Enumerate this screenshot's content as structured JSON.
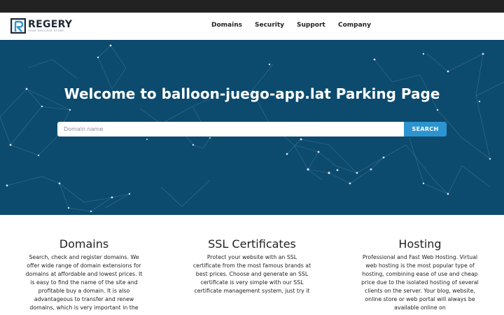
{
  "brand": {
    "name": "REGERY",
    "tagline": "YOUR SUCCESS STORY",
    "colors": {
      "primary": "#1f2a36",
      "accent": "#2c95d1",
      "hero_bg": "#0c4a6e"
    }
  },
  "nav": {
    "items": [
      {
        "label": "Domains"
      },
      {
        "label": "Security"
      },
      {
        "label": "Support"
      },
      {
        "label": "Company"
      }
    ]
  },
  "hero": {
    "title": "Welcome to balloon-juego-app.lat Parking Page",
    "search": {
      "placeholder": "Domain name",
      "value": "",
      "button_label": "SEARCH"
    }
  },
  "features": [
    {
      "title": "Domains",
      "text": "Search, check and register domains. We offer wide range of domain extensions for domains at affordable and lowest prices. It is easy to find the name of the site and profitable buy a domain. It is also advantageous to transfer and renew domains, which is very important in the"
    },
    {
      "title": "SSL Certificates",
      "text": "Protect your website with an SSL certificate from the most famous brands at best prices. Choose and generate an SSL certificate is very simple with our SSL certificate management system, just try it"
    },
    {
      "title": "Hosting",
      "text": "Professional and Fast Web Hosting. Virtual web hosting is the most popular type of hosting, combining ease of use and cheap price due to the isolated hosting of several clients on the server. Your blog, website, online store or web portal will always be available online on"
    }
  ]
}
